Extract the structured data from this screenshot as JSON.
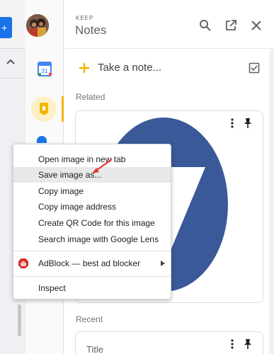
{
  "panel": {
    "eyebrow": "KEEP",
    "title": "Notes",
    "take_note": "Take a note...",
    "related_label": "Related",
    "recent_label": "Recent",
    "recent_card_title": "Title"
  },
  "context_menu": {
    "items": [
      "Open image in new tab",
      "Save image as...",
      "Copy image",
      "Copy image address",
      "Create QR Code for this image",
      "Search image with Google Lens",
      "AdBlock — best ad blocker",
      "Inspect"
    ],
    "highlighted_item": "Save image as..."
  },
  "colors": {
    "keep_accent": "#f4b400",
    "note_image_blue": "#3a5998",
    "adblock_red": "#d93025",
    "annotation_arrow": "#e53935"
  },
  "icons": [
    "search-icon",
    "open-in-new-icon",
    "close-icon",
    "plus-icon",
    "checkbox-icon",
    "more-vert-icon",
    "pin-icon",
    "calendar-icon",
    "keep-icon",
    "adblock-icon",
    "chevron-up-icon",
    "chevron-right-icon"
  ]
}
